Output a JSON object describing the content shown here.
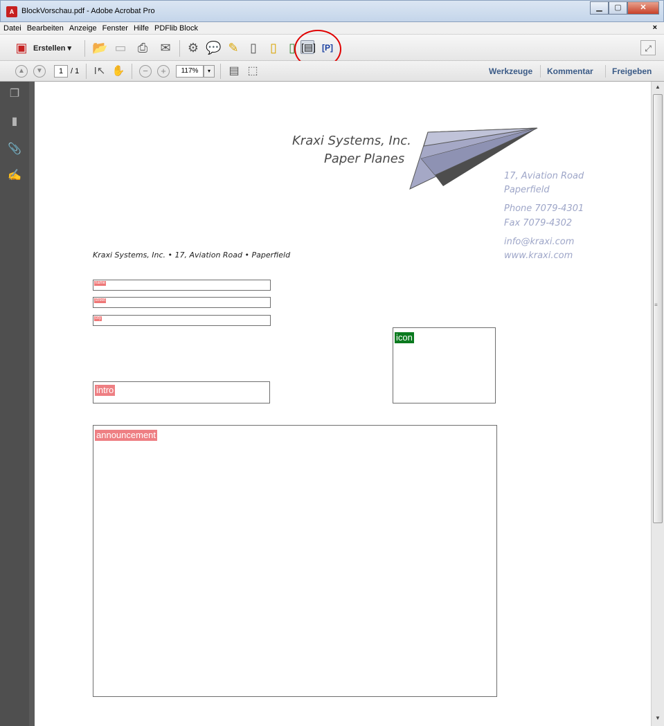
{
  "window": {
    "title": "BlockVorschau.pdf - Adobe Acrobat Pro",
    "app_icon": "acrobat-icon"
  },
  "menu": [
    "Datei",
    "Bearbeiten",
    "Anzeige",
    "Fenster",
    "Hilfe",
    "PDFlib Block"
  ],
  "menu_close": "×",
  "toolbar": {
    "create_label": "Erstellen"
  },
  "nav": {
    "page_number": "1",
    "page_total": "/ 1",
    "zoom": "117%"
  },
  "panels": {
    "tools": "Werkzeuge",
    "comment": "Kommentar",
    "share": "Freigeben"
  },
  "page": {
    "company_name": "Kraxi Systems, Inc.",
    "company_tagline": "Paper Planes",
    "address_line1": "17, Aviation Road",
    "address_line2": "Paperfield",
    "phone": "Phone 7079-4301",
    "fax": "Fax 7079-4302",
    "email": "info@kraxi.com",
    "web": "www.kraxi.com",
    "sender_line": "Kraxi Systems, Inc. • 17, Aviation Road • Paperfield",
    "blocks": {
      "name": "name",
      "street": "street",
      "city": "city",
      "intro": "intro",
      "icon": "icon",
      "announcement": "announcement"
    }
  },
  "colors": {
    "block_label": "#ee7f83",
    "image_block_label": "#0b7a1f",
    "contact_text": "#9ea6c8",
    "highlight_circle": "#e00000"
  }
}
